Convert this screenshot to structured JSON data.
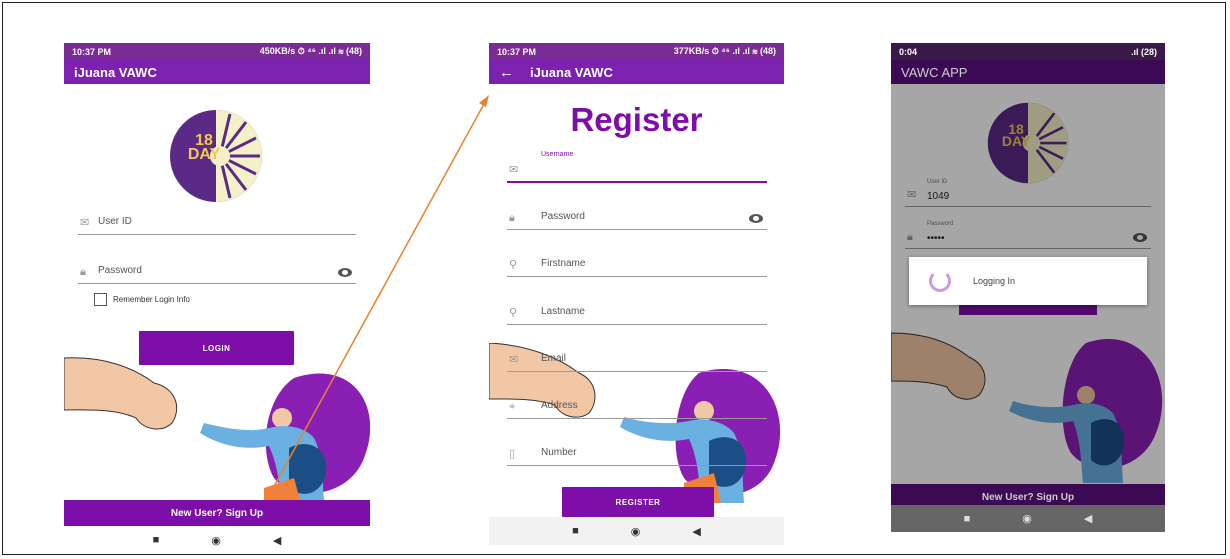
{
  "screen1": {
    "status": {
      "time": "10:37 PM",
      "right": "450KB/s ⏱ ⁴⁶ .ıl .ıl ≋ (48)"
    },
    "app_title": "iJuana VAWC",
    "logo": {
      "top": "18",
      "bottom": "DAY"
    },
    "user_id_placeholder": "User ID",
    "password_placeholder": "Password",
    "remember_label": "Remember Login Info",
    "login_label": "LOGIN",
    "signup_label": "New User? Sign Up"
  },
  "screen2": {
    "status": {
      "time": "10:37 PM",
      "right": "377KB/s ⏱ ⁴⁶ .ıl .ıl ≋ (48)"
    },
    "app_title": "iJuana VAWC",
    "heading": "Register",
    "username_label": "Username",
    "fields": [
      "Password",
      "Firstname",
      "Lastname",
      "Email",
      "Address",
      "Number"
    ],
    "register_label": "REGISTER"
  },
  "screen3": {
    "status": {
      "time": "0:04",
      "right": ".ıl (28)"
    },
    "app_title": "VAWC APP",
    "logo": {
      "top": "18",
      "bottom": "DAY"
    },
    "user_id_label": "User ID",
    "user_id_value": "1049",
    "password_label": "Password",
    "password_value": "•••••",
    "dialog_text": "Logging In",
    "signup_label": "New User? Sign Up"
  },
  "nav": {
    "recent": "■",
    "home": "◉",
    "back": "◀"
  },
  "colors": {
    "brand": "#7d0fa8",
    "status": "#7b2b95",
    "arrow": "#e8822d"
  }
}
